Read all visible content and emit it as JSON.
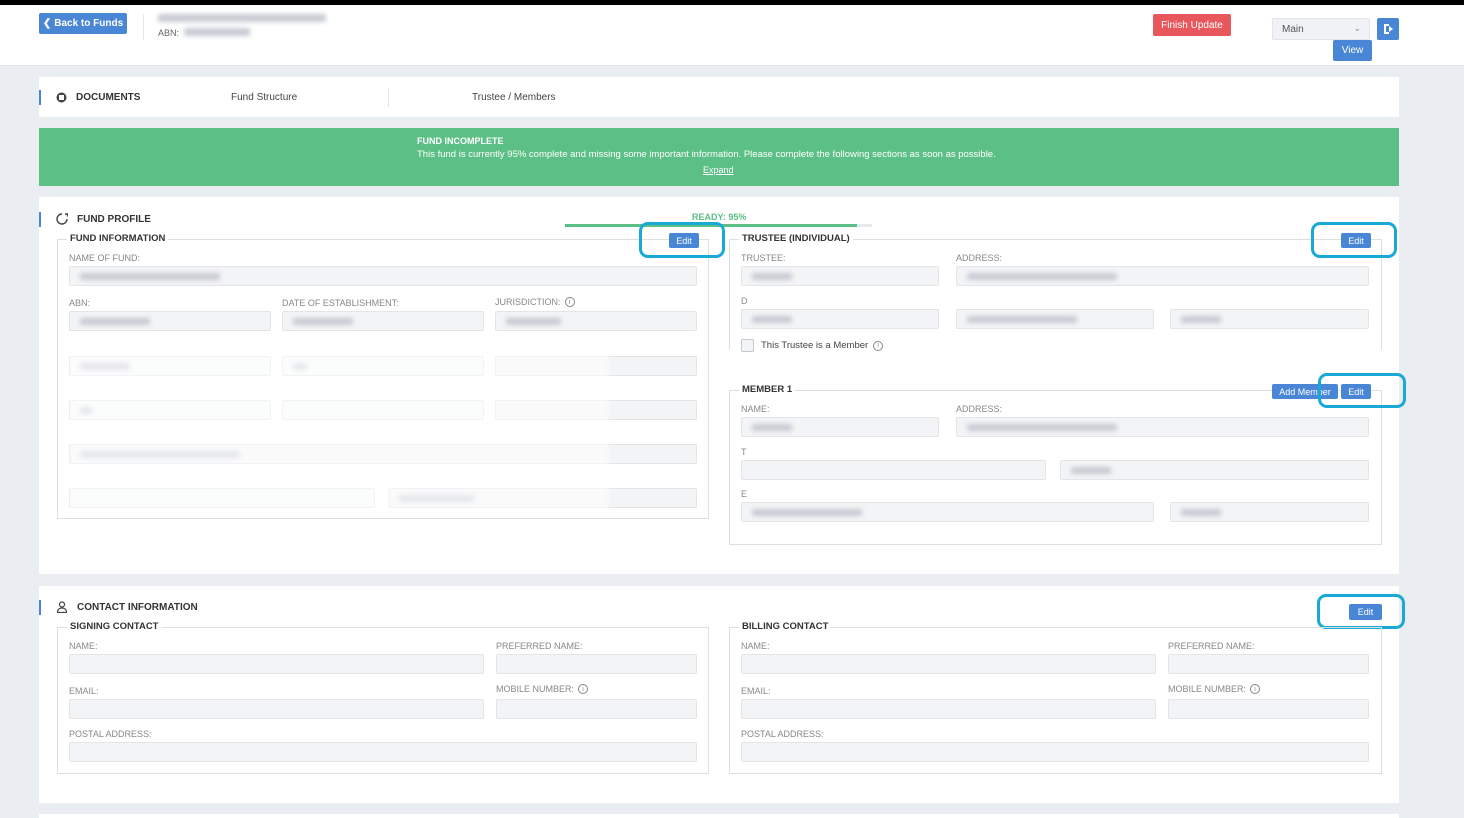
{
  "header": {
    "back_label": "Back to Funds",
    "abn_label": "ABN:",
    "finish_label": "Finish Update",
    "select_value": "Main",
    "view_label": "View"
  },
  "tabs": {
    "documents": "DOCUMENTS",
    "fund_structure": "Fund Structure",
    "trustee_members": "Trustee / Members"
  },
  "banner": {
    "title": "FUND INCOMPLETE",
    "text": "This fund is currently 95% complete and missing some important information. Please complete the following sections as soon as possible.",
    "expand": "Expand",
    "color": "#5cbf85"
  },
  "profile": {
    "title": "FUND PROFILE",
    "progress_label": "READY: 95%",
    "progress_value": 0.95,
    "fund_info": {
      "legend": "FUND INFORMATION",
      "edit": "Edit",
      "name_label": "NAME OF FUND:",
      "abn_label": "ABN:",
      "doe_label": "DATE OF ESTABLISHMENT:",
      "jurisdiction_label": "JURISDICTION:"
    },
    "trustee": {
      "legend": "TRUSTEE (INDIVIDUAL)",
      "edit": "Edit",
      "trustee_label": "TRUSTEE:",
      "address_label": "ADDRESS:",
      "d_label": "D",
      "checkbox_label": "This Trustee is a Member"
    },
    "member": {
      "legend": "MEMBER 1",
      "add_label": "Add Member",
      "edit": "Edit",
      "name_label": "NAME:",
      "address_label": "ADDRESS:",
      "t_label": "T",
      "e_label": "E"
    }
  },
  "contact": {
    "title": "CONTACT INFORMATION",
    "edit": "Edit",
    "signing": {
      "legend": "SIGNING CONTACT",
      "name_label": "NAME:",
      "preferred_label": "PREFERRED NAME:",
      "email_label": "EMAIL:",
      "mobile_label": "MOBILE NUMBER:",
      "postal_label": "POSTAL ADDRESS:"
    },
    "billing": {
      "legend": "BILLING CONTACT",
      "name_label": "NAME:",
      "preferred_label": "PREFERRED NAME:",
      "email_label": "EMAIL:",
      "mobile_label": "MOBILE NUMBER:",
      "postal_label": "POSTAL ADDRESS:"
    }
  },
  "colors": {
    "accent": "#4a86d6",
    "finish": "#e8575c",
    "highlight_ring": "#1aa9d6"
  }
}
